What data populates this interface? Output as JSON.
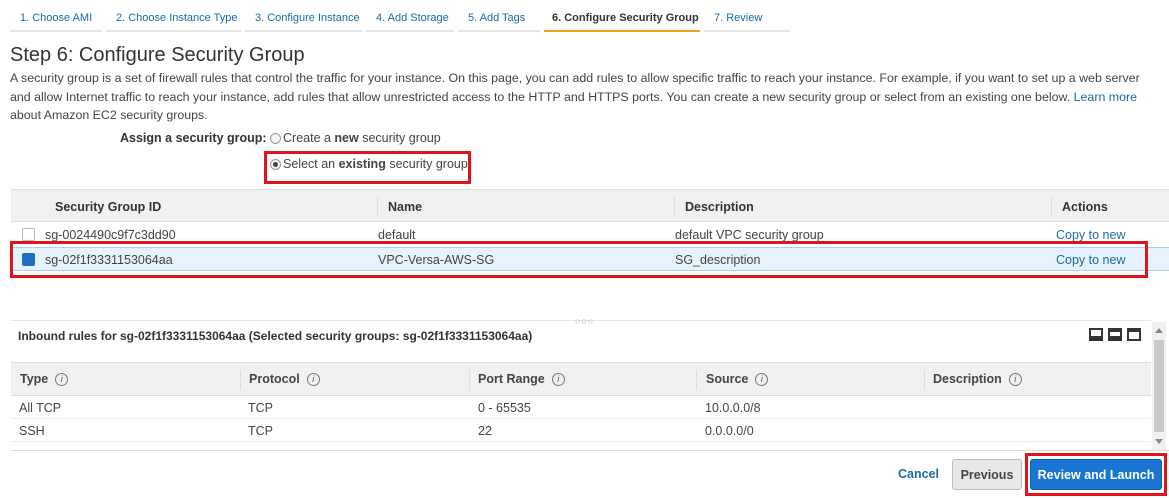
{
  "wizard": {
    "tabs": [
      {
        "label": "1. Choose AMI"
      },
      {
        "label": "2. Choose Instance Type"
      },
      {
        "label": "3. Configure Instance"
      },
      {
        "label": "4. Add Storage"
      },
      {
        "label": "5. Add Tags"
      },
      {
        "label": "6. Configure Security Group",
        "active": true
      },
      {
        "label": "7. Review"
      }
    ]
  },
  "page": {
    "title": "Step 6: Configure Security Group",
    "intro": "A security group is a set of firewall rules that control the traffic for your instance. On this page, you can add rules to allow specific traffic to reach your instance. For example, if you want to set up a web server and allow Internet traffic to reach your instance, add rules that allow unrestricted access to the HTTP and HTTPS ports. You can create a new security group or select from an existing one below.",
    "learn_more": "Learn more",
    "intro_tail": "about Amazon EC2 security groups."
  },
  "assign": {
    "label": "Assign a security group:",
    "option_new_pre": "Create a ",
    "option_new_bold": "new",
    "option_new_post": " security group",
    "option_existing_pre": "Select an ",
    "option_existing_bold": "existing",
    "option_existing_post": " security group",
    "selected": "existing"
  },
  "sg_table": {
    "headers": {
      "id": "Security Group ID",
      "name": "Name",
      "description": "Description",
      "actions": "Actions"
    },
    "rows": [
      {
        "id": "sg-0024490c9f7c3dd90",
        "name": "default",
        "description": "default VPC security group",
        "action": "Copy to new",
        "checked": false
      },
      {
        "id": "sg-02f1f3331153064aa",
        "name": "VPC-Versa-AWS-SG",
        "description": "SG_description",
        "action": "Copy to new",
        "checked": true
      }
    ]
  },
  "splitter": "○○○",
  "inbound": {
    "title": "Inbound rules for sg-02f1f3331153064aa (Selected security groups: sg-02f1f3331153064aa)",
    "headers": {
      "type": "Type",
      "protocol": "Protocol",
      "port_range": "Port Range",
      "source": "Source",
      "description": "Description"
    },
    "info_glyph": "i",
    "rows": [
      {
        "type": "All TCP",
        "protocol": "TCP",
        "port_range": "0 - 65535",
        "source": "10.0.0.0/8",
        "description": ""
      },
      {
        "type": "SSH",
        "protocol": "TCP",
        "port_range": "22",
        "source": "0.0.0.0/0",
        "description": ""
      }
    ]
  },
  "footer": {
    "cancel": "Cancel",
    "previous": "Previous",
    "launch": "Review and Launch"
  },
  "colors": {
    "link": "#1a6aa8",
    "active_tab_underline": "#f0a11a",
    "primary_button": "#1976d2",
    "highlight_box": "#e0141b",
    "selected_row": "#e7f3fc"
  }
}
